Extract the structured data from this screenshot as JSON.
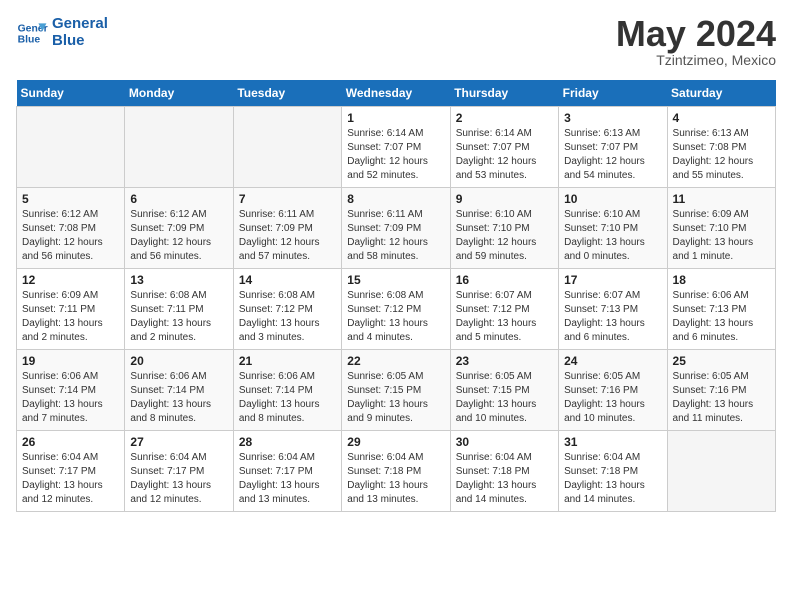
{
  "header": {
    "logo_general": "General",
    "logo_blue": "Blue",
    "month_year": "May 2024",
    "location": "Tzintzimeo, Mexico"
  },
  "days_of_week": [
    "Sunday",
    "Monday",
    "Tuesday",
    "Wednesday",
    "Thursday",
    "Friday",
    "Saturday"
  ],
  "weeks": [
    {
      "cells": [
        {
          "day": "",
          "info": "",
          "empty": true
        },
        {
          "day": "",
          "info": "",
          "empty": true
        },
        {
          "day": "",
          "info": "",
          "empty": true
        },
        {
          "day": "1",
          "info": "Sunrise: 6:14 AM\nSunset: 7:07 PM\nDaylight: 12 hours and 52 minutes."
        },
        {
          "day": "2",
          "info": "Sunrise: 6:14 AM\nSunset: 7:07 PM\nDaylight: 12 hours and 53 minutes."
        },
        {
          "day": "3",
          "info": "Sunrise: 6:13 AM\nSunset: 7:07 PM\nDaylight: 12 hours and 54 minutes."
        },
        {
          "day": "4",
          "info": "Sunrise: 6:13 AM\nSunset: 7:08 PM\nDaylight: 12 hours and 55 minutes."
        }
      ]
    },
    {
      "cells": [
        {
          "day": "5",
          "info": "Sunrise: 6:12 AM\nSunset: 7:08 PM\nDaylight: 12 hours and 56 minutes."
        },
        {
          "day": "6",
          "info": "Sunrise: 6:12 AM\nSunset: 7:09 PM\nDaylight: 12 hours and 56 minutes."
        },
        {
          "day": "7",
          "info": "Sunrise: 6:11 AM\nSunset: 7:09 PM\nDaylight: 12 hours and 57 minutes."
        },
        {
          "day": "8",
          "info": "Sunrise: 6:11 AM\nSunset: 7:09 PM\nDaylight: 12 hours and 58 minutes."
        },
        {
          "day": "9",
          "info": "Sunrise: 6:10 AM\nSunset: 7:10 PM\nDaylight: 12 hours and 59 minutes."
        },
        {
          "day": "10",
          "info": "Sunrise: 6:10 AM\nSunset: 7:10 PM\nDaylight: 13 hours and 0 minutes."
        },
        {
          "day": "11",
          "info": "Sunrise: 6:09 AM\nSunset: 7:10 PM\nDaylight: 13 hours and 1 minute."
        }
      ]
    },
    {
      "cells": [
        {
          "day": "12",
          "info": "Sunrise: 6:09 AM\nSunset: 7:11 PM\nDaylight: 13 hours and 2 minutes."
        },
        {
          "day": "13",
          "info": "Sunrise: 6:08 AM\nSunset: 7:11 PM\nDaylight: 13 hours and 2 minutes."
        },
        {
          "day": "14",
          "info": "Sunrise: 6:08 AM\nSunset: 7:12 PM\nDaylight: 13 hours and 3 minutes."
        },
        {
          "day": "15",
          "info": "Sunrise: 6:08 AM\nSunset: 7:12 PM\nDaylight: 13 hours and 4 minutes."
        },
        {
          "day": "16",
          "info": "Sunrise: 6:07 AM\nSunset: 7:12 PM\nDaylight: 13 hours and 5 minutes."
        },
        {
          "day": "17",
          "info": "Sunrise: 6:07 AM\nSunset: 7:13 PM\nDaylight: 13 hours and 6 minutes."
        },
        {
          "day": "18",
          "info": "Sunrise: 6:06 AM\nSunset: 7:13 PM\nDaylight: 13 hours and 6 minutes."
        }
      ]
    },
    {
      "cells": [
        {
          "day": "19",
          "info": "Sunrise: 6:06 AM\nSunset: 7:14 PM\nDaylight: 13 hours and 7 minutes."
        },
        {
          "day": "20",
          "info": "Sunrise: 6:06 AM\nSunset: 7:14 PM\nDaylight: 13 hours and 8 minutes."
        },
        {
          "day": "21",
          "info": "Sunrise: 6:06 AM\nSunset: 7:14 PM\nDaylight: 13 hours and 8 minutes."
        },
        {
          "day": "22",
          "info": "Sunrise: 6:05 AM\nSunset: 7:15 PM\nDaylight: 13 hours and 9 minutes."
        },
        {
          "day": "23",
          "info": "Sunrise: 6:05 AM\nSunset: 7:15 PM\nDaylight: 13 hours and 10 minutes."
        },
        {
          "day": "24",
          "info": "Sunrise: 6:05 AM\nSunset: 7:16 PM\nDaylight: 13 hours and 10 minutes."
        },
        {
          "day": "25",
          "info": "Sunrise: 6:05 AM\nSunset: 7:16 PM\nDaylight: 13 hours and 11 minutes."
        }
      ]
    },
    {
      "cells": [
        {
          "day": "26",
          "info": "Sunrise: 6:04 AM\nSunset: 7:17 PM\nDaylight: 13 hours and 12 minutes."
        },
        {
          "day": "27",
          "info": "Sunrise: 6:04 AM\nSunset: 7:17 PM\nDaylight: 13 hours and 12 minutes."
        },
        {
          "day": "28",
          "info": "Sunrise: 6:04 AM\nSunset: 7:17 PM\nDaylight: 13 hours and 13 minutes."
        },
        {
          "day": "29",
          "info": "Sunrise: 6:04 AM\nSunset: 7:18 PM\nDaylight: 13 hours and 13 minutes."
        },
        {
          "day": "30",
          "info": "Sunrise: 6:04 AM\nSunset: 7:18 PM\nDaylight: 13 hours and 14 minutes."
        },
        {
          "day": "31",
          "info": "Sunrise: 6:04 AM\nSunset: 7:18 PM\nDaylight: 13 hours and 14 minutes."
        },
        {
          "day": "",
          "info": "",
          "empty": true
        }
      ]
    }
  ]
}
